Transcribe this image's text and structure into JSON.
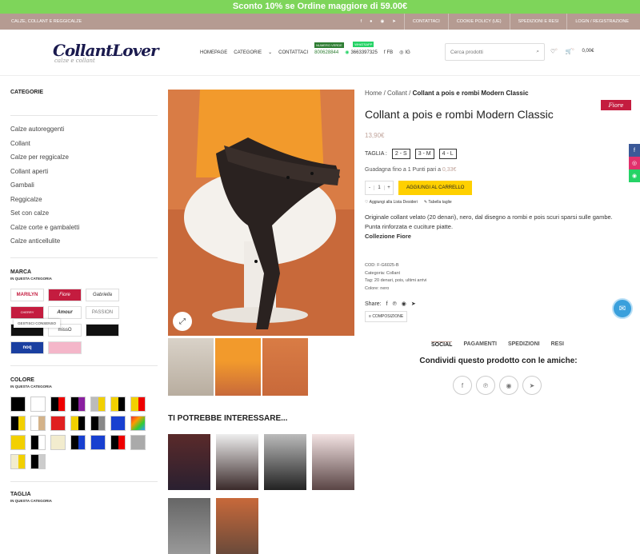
{
  "promo": "Sconto 10% se Ordine maggiore di 59.00€",
  "topbar": {
    "left": "CALZE, COLLANT E REGGICALZE",
    "links": [
      "CONTATTACI",
      "COOKIE POLICY (UE)",
      "SPEDIZIONI E RESI",
      "LOGIN / REGISTRAZIONE"
    ]
  },
  "logo": {
    "name": "CollantLover",
    "tagline": "calze e collant"
  },
  "nav": {
    "items": [
      "HOMEPAGE",
      "CATEGORIE",
      "CONTATTACI"
    ],
    "phone1_badge": "NUMERO VERDE",
    "phone1": "800628844",
    "phone2_badge": "WHATSAPP",
    "phone2": "3663397325",
    "fb": "FB",
    "ig": "IG"
  },
  "search": {
    "placeholder": "Cerca prodotti"
  },
  "cart": {
    "total": "0,00€",
    "count": "0",
    "wish_count": "0"
  },
  "sidebar": {
    "categories_title": "CATEGORIE",
    "categories": [
      "Calze autoreggenti",
      "Collant",
      "Calze per reggicalze",
      "Collant aperti",
      "Gambali",
      "Reggicalze",
      "Set con calze",
      "Calze corte e gambaletti",
      "Calze anticellulite"
    ],
    "brand_title": "MARCA",
    "brand_sub": "IN QUESTA CATEGORIA",
    "brands": [
      "MARILYN",
      "Fiore",
      "Gabriella",
      "CHERRY",
      "Amour",
      "PASSION",
      "",
      "missO",
      "",
      "noq",
      "",
      ""
    ],
    "color_title": "COLORE",
    "color_sub": "IN QUESTA CATEGORIA",
    "size_title": "TAGLIA",
    "size_sub": "IN QUESTA CATEGORIA",
    "consent": "GESTISCI CONSENSO"
  },
  "product": {
    "breadcrumb": [
      "Home",
      "Collant"
    ],
    "breadcrumb_current": "Collant a pois e rombi Modern Classic",
    "brand_badge": "Fiore",
    "title": "Collant a pois e rombi Modern Classic",
    "price": "13,90€",
    "size_label": "TAGLIA :",
    "sizes": [
      "2 - S",
      "3 - M",
      "4 - L"
    ],
    "points_text": "Guadagna fino a 1 Punti pari a ",
    "points_value": "0,33€",
    "qty": "1",
    "add_to_cart": "AGGIUNGI AL CARRELLO",
    "wishlist": "Aggiungi alla Lista Desideri",
    "size_table": "Tabella taglie",
    "desc1": "Originale collant velato (20 denari), nero, dal disegno a rombi e pois scuri sparsi sulle gambe.",
    "desc2": "Punta rinforzata e cuciture piatte.",
    "desc3": "Collezione Fiore",
    "sku": "COD: F-G6025-B",
    "category": "Categoria: Collant",
    "tags": "Tag: 20 denari, pois, ultimi arrivi",
    "color": "Colore: nero",
    "share": "Share:",
    "composition": "COMPOSIZIONE"
  },
  "tabs": [
    "SOCIAL",
    "PAGAMENTI",
    "SPEDIZIONI",
    "RESI"
  ],
  "share_heading": "Condividi questo prodotto con le amiche:",
  "related_title": "TI POTREBBE INTERESSARE...",
  "colors": {
    "promo": "#7ed55a",
    "topbar": "#b59b92",
    "accent": "#c0a39a",
    "cta": "#ffd000"
  }
}
